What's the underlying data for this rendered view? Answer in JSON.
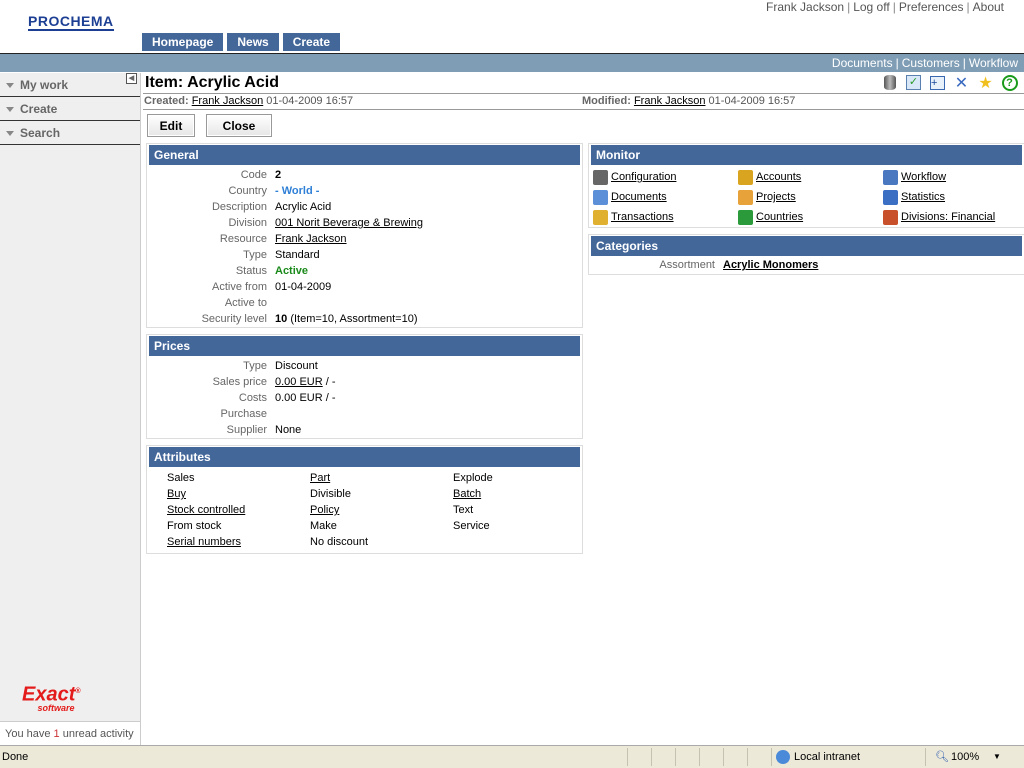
{
  "header": {
    "logo": "PROCHEMA",
    "user": "Frank Jackson",
    "logoff": "Log off",
    "preferences": "Preferences",
    "about": "About",
    "tabs": [
      "Homepage",
      "News",
      "Create"
    ]
  },
  "subnav": [
    "Documents",
    "Customers",
    "Workflow"
  ],
  "sidebar": {
    "items": [
      "My work",
      "Create",
      "Search"
    ],
    "brand": "Exact",
    "brand_sub": "software",
    "unread_pre": "You have",
    "unread_count": "1",
    "unread_post": "unread activity"
  },
  "item": {
    "title": "Item: Acrylic Acid",
    "created_label": "Created:",
    "created_by": "Frank Jackson",
    "created_at": "01-04-2009 16:57",
    "modified_label": "Modified:",
    "modified_by": "Frank Jackson",
    "modified_at": "01-04-2009 16:57",
    "toolbar_icons": [
      "database-icon",
      "checklist-icon",
      "new-window-icon",
      "tools-icon",
      "favorite-icon",
      "help-icon"
    ]
  },
  "buttons": {
    "edit": "Edit",
    "close": "Close"
  },
  "general": {
    "title": "General",
    "rows": [
      {
        "label": "Code",
        "value": "2"
      },
      {
        "label": "Country",
        "value": "- World -"
      },
      {
        "label": "Description",
        "value": "Acrylic Acid"
      },
      {
        "label": "Division",
        "value": "001 Norit Beverage & Brewing"
      },
      {
        "label": "Resource",
        "value": "Frank Jackson"
      },
      {
        "label": "Type",
        "value": "Standard"
      },
      {
        "label": "Status",
        "value": "Active"
      },
      {
        "label": "Active from",
        "value": "01-04-2009"
      },
      {
        "label": "Active to",
        "value": ""
      },
      {
        "label": "Security level",
        "value": "10",
        "extra": "(Item=10, Assortment=10)"
      }
    ]
  },
  "prices": {
    "title": "Prices",
    "rows": [
      {
        "label": "Type",
        "value": "Discount"
      },
      {
        "label": "Sales price",
        "value": "0.00 EUR",
        "extra": "/ -"
      },
      {
        "label": "Costs",
        "value": "0.00 EUR / -"
      },
      {
        "label": "Purchase",
        "value": ""
      },
      {
        "label": "Supplier",
        "value": "None"
      }
    ]
  },
  "attributes": {
    "title": "Attributes",
    "items": [
      {
        "label": "Sales",
        "link": false
      },
      {
        "label": "Part",
        "link": true
      },
      {
        "label": "Explode",
        "link": false
      },
      {
        "label": "Buy",
        "link": true
      },
      {
        "label": "Divisible",
        "link": false
      },
      {
        "label": "Batch",
        "link": true
      },
      {
        "label": "Stock controlled",
        "link": true
      },
      {
        "label": "Policy",
        "link": true
      },
      {
        "label": "Text",
        "link": false
      },
      {
        "label": "From stock",
        "link": false
      },
      {
        "label": "Make",
        "link": false
      },
      {
        "label": "Service",
        "link": false
      },
      {
        "label": "Serial numbers",
        "link": true
      },
      {
        "label": "No discount",
        "link": false
      }
    ]
  },
  "monitor": {
    "title": "Monitor",
    "items": [
      {
        "label": "Configuration",
        "icon": "wrench-icon",
        "color": "#666666"
      },
      {
        "label": "Accounts",
        "icon": "user-icon",
        "color": "#d9a520"
      },
      {
        "label": "Workflow",
        "icon": "workflow-icon",
        "color": "#4a78c0"
      },
      {
        "label": "Documents",
        "icon": "document-icon",
        "color": "#5b8fd8"
      },
      {
        "label": "Projects",
        "icon": "projects-icon",
        "color": "#e7a23a"
      },
      {
        "label": "Statistics",
        "icon": "chart-icon",
        "color": "#3b6fc4"
      },
      {
        "label": "Transactions",
        "icon": "transactions-icon",
        "color": "#e0b030"
      },
      {
        "label": "Countries",
        "icon": "globe-icon",
        "color": "#2a9a3a"
      },
      {
        "label": "Divisions: Financial",
        "icon": "building-icon",
        "color": "#c8502a"
      }
    ]
  },
  "categories": {
    "title": "Categories",
    "label": "Assortment",
    "value": "Acrylic Monomers"
  },
  "statusbar": {
    "text": "Done",
    "zone": "Local intranet",
    "zoom": "100%"
  }
}
